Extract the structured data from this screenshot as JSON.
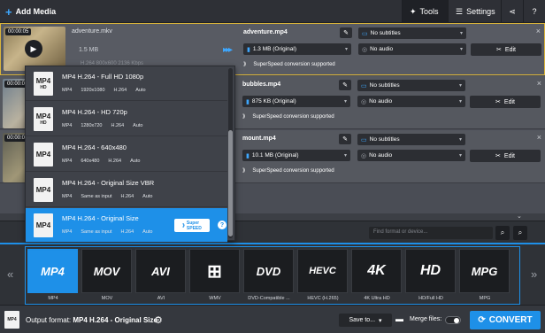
{
  "topbar": {
    "add_media": "Add Media",
    "tools": "Tools",
    "settings": "Settings"
  },
  "files": [
    {
      "duration": "00:00:05",
      "source_name": "adventure.mkv",
      "source_size": "1.5 MB",
      "source_meta": "H.264 800x600 2136 Kbps",
      "output_name": "adventure.mp4",
      "output_size": "1.3 MB (Original)",
      "subtitles": "No subtitles",
      "audio": "No audio",
      "speed_text": "SuperSpeed conversion supported",
      "edit_label": "Edit"
    },
    {
      "duration": "00:00:05",
      "output_name": "bubbles.mp4",
      "output_size": "875 KB (Original)",
      "subtitles": "No subtitles",
      "audio": "No audio",
      "speed_text": "SuperSpeed conversion supported",
      "edit_label": "Edit"
    },
    {
      "duration": "00:00:05",
      "output_name": "mount.mp4",
      "output_size": "10.1 MB (Original)",
      "subtitles": "No subtitles",
      "audio": "No audio",
      "speed_text": "SuperSpeed conversion supported",
      "edit_label": "Edit"
    }
  ],
  "dropdown": {
    "items": [
      {
        "icon_top": "MP4",
        "icon_bottom": "HD",
        "title": "MP4 H.264 - Full HD 1080p",
        "container": "MP4",
        "resolution": "1920x1080",
        "codec": "H.264",
        "bitrate": "Auto"
      },
      {
        "icon_top": "MP4",
        "icon_bottom": "HD",
        "title": "MP4 H.264 - HD 720p",
        "container": "MP4",
        "resolution": "1280x720",
        "codec": "H.264",
        "bitrate": "Auto"
      },
      {
        "icon_top": "MP4",
        "icon_bottom": "",
        "title": "MP4 H.264 - 640x480",
        "container": "MP4",
        "resolution": "640x480",
        "codec": "H.264",
        "bitrate": "Auto"
      },
      {
        "icon_top": "MP4",
        "icon_bottom": "",
        "title": "MP4 H.264 - Original Size VBR",
        "container": "MP4",
        "resolution": "Same as input",
        "codec": "H.264",
        "bitrate": "Auto"
      },
      {
        "icon_top": "MP4",
        "icon_bottom": "",
        "title": "MP4 H.264 - Original Size",
        "container": "MP4",
        "resolution": "Same as input",
        "codec": "H.264",
        "bitrate": "Auto"
      }
    ],
    "super_label_1": "Super",
    "super_label_2": "SPEED",
    "help": "?"
  },
  "formats": {
    "search_placeholder": "Find format or device...",
    "tiles": [
      {
        "logo": "MP4",
        "label": "MP4"
      },
      {
        "logo": "MOV",
        "label": "MOV"
      },
      {
        "logo": "AVI",
        "label": "AVI"
      },
      {
        "logo": "⊞",
        "label": "WMV"
      },
      {
        "logo": "DVD",
        "label": "DVD-Compatible ..."
      },
      {
        "logo": "HEVC",
        "label": "HEVC (H.265)"
      },
      {
        "logo": "4K",
        "label": "4K Ultra HD"
      },
      {
        "logo": "HD",
        "label": "HD/Full HD"
      },
      {
        "logo": "MPG",
        "label": "MPG"
      }
    ]
  },
  "bottombar": {
    "icon_text": "MP4",
    "output_format_label": "Output format:",
    "output_format_value": "MP4 H.264 - Original Size",
    "save_to": "Save to...",
    "merge_files": "Merge files:",
    "convert": "CONVERT"
  },
  "colors": {
    "accent": "#1e90e8",
    "selected_border": "#d9b43a"
  }
}
